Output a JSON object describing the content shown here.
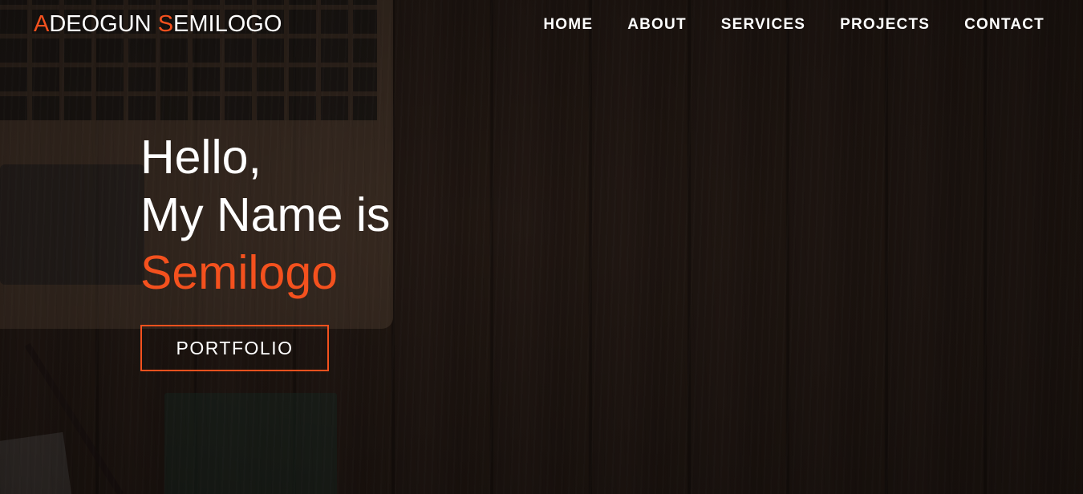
{
  "brand": {
    "first_initial": "A",
    "first_rest": "DEOGUN ",
    "last_initial": "S",
    "last_rest": "EMILOGO"
  },
  "nav": {
    "items": [
      {
        "label": "HOME"
      },
      {
        "label": "ABOUT"
      },
      {
        "label": "SERVICES"
      },
      {
        "label": "PROJECTS"
      },
      {
        "label": "CONTACT"
      }
    ]
  },
  "hero": {
    "greeting": "Hello,",
    "intro": "My Name is",
    "name": "Semilogo",
    "button_label": "PORTFOLIO"
  },
  "colors": {
    "accent": "#f4511e",
    "text": "#ffffff",
    "background": "#2a1d17"
  }
}
